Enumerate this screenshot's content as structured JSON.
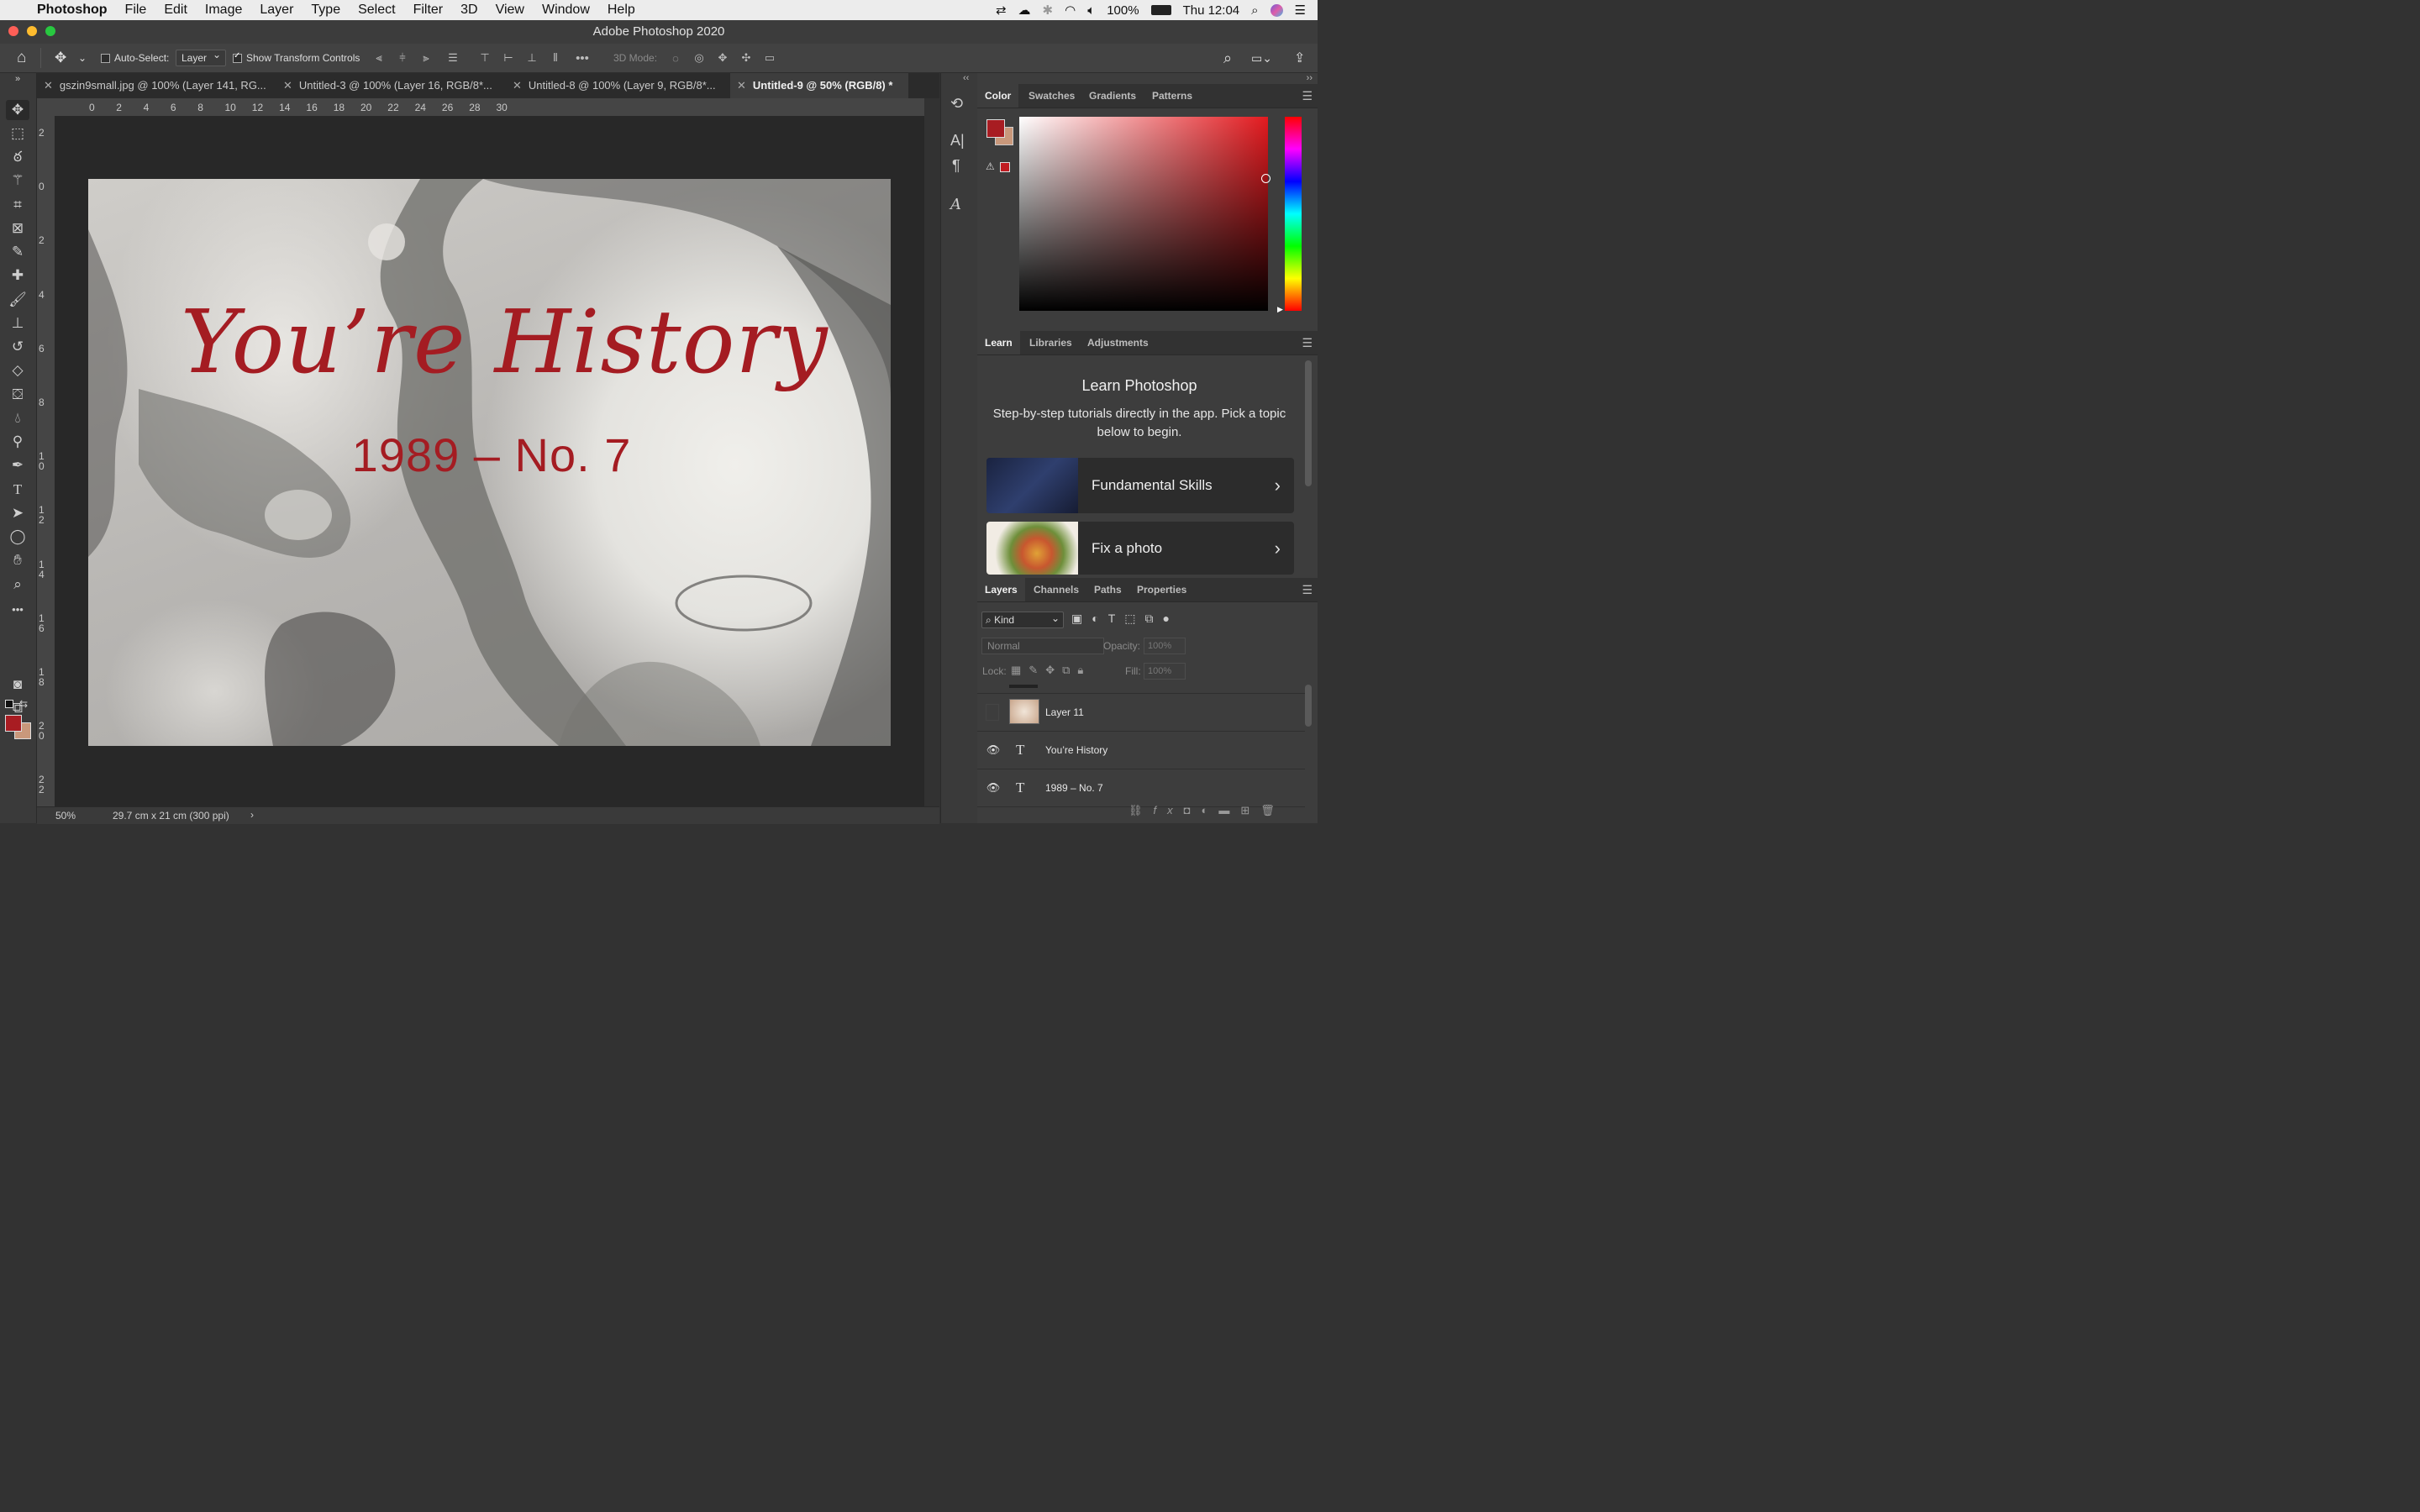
{
  "menubar": {
    "app": "Photoshop",
    "items": [
      "File",
      "Edit",
      "Image",
      "Layer",
      "Type",
      "Select",
      "Filter",
      "3D",
      "View",
      "Window",
      "Help"
    ],
    "battery": "100%",
    "clock": "Thu 12:04"
  },
  "window": {
    "title": "Adobe Photoshop 2020"
  },
  "options": {
    "auto_select_label": "Auto-Select:",
    "auto_select_value": "Layer",
    "show_transform_label": "Show Transform Controls",
    "three_d_label": "3D Mode:"
  },
  "tabs": [
    {
      "label": "gszin9small.jpg @ 100% (Layer 141, RG..."
    },
    {
      "label": "Untitled-3 @ 100% (Layer 16, RGB/8*..."
    },
    {
      "label": "Untitled-8 @ 100% (Layer 9, RGB/8*..."
    },
    {
      "label": "Untitled-9 @ 50% (RGB/8) *"
    }
  ],
  "ruler": {
    "h": [
      "0",
      "2",
      "4",
      "6",
      "8",
      "10",
      "12",
      "14",
      "16",
      "18",
      "20",
      "22",
      "24",
      "26",
      "28",
      "30"
    ],
    "v": [
      "2",
      "0",
      "2",
      "4",
      "6",
      "8",
      "1\n0",
      "1\n2",
      "1\n4",
      "1\n6",
      "1\n8",
      "2\n0",
      "2\n2"
    ]
  },
  "artwork": {
    "title": "You’re History",
    "subtitle": "1989 – No. 7",
    "text_color": "#a41c22"
  },
  "status": {
    "zoom": "50%",
    "doc_info": "29.7 cm x 21 cm (300 ppi)"
  },
  "color_panel": {
    "tabs": [
      "Color",
      "Swatches",
      "Gradients",
      "Patterns"
    ],
    "foreground": "#a81c22",
    "background": "#c9987b"
  },
  "learn_panel": {
    "tabs": [
      "Learn",
      "Libraries",
      "Adjustments"
    ],
    "heading": "Learn Photoshop",
    "description": "Step-by-step tutorials directly in the app. Pick a topic below to begin.",
    "cards": [
      {
        "label": "Fundamental Skills"
      },
      {
        "label": "Fix a photo"
      }
    ]
  },
  "layers_panel": {
    "tabs": [
      "Layers",
      "Channels",
      "Paths",
      "Properties"
    ],
    "filter_kind": "Kind",
    "blend_mode": "Normal",
    "opacity_label": "Opacity:",
    "opacity_value": "100%",
    "lock_label": "Lock:",
    "fill_label": "Fill:",
    "fill_value": "100%",
    "layers": [
      {
        "name": "Layer 11",
        "type": "pixel",
        "visible": false
      },
      {
        "name": "You’re History",
        "type": "text",
        "visible": true
      },
      {
        "name": "1989 – No. 7",
        "type": "text",
        "visible": true
      }
    ]
  }
}
